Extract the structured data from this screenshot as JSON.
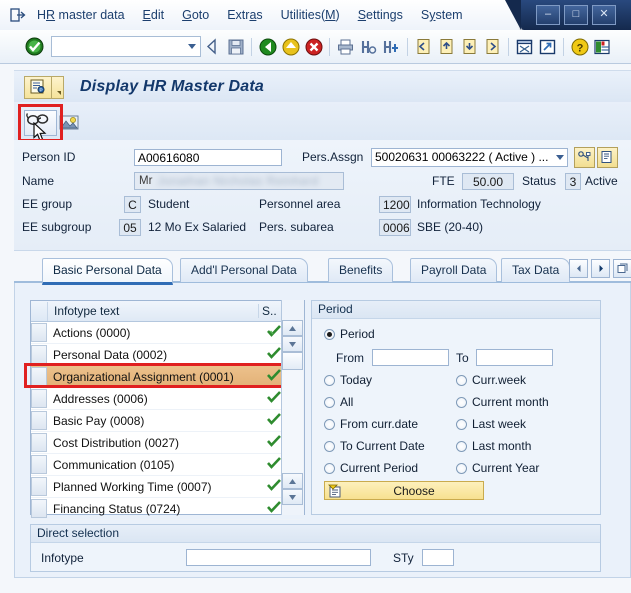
{
  "window": {
    "controls": [
      {
        "name": "minimize",
        "glyph": "–"
      },
      {
        "name": "maximize",
        "glyph": "□"
      },
      {
        "name": "close",
        "glyph": "✕"
      }
    ],
    "overflow_glyph": "»"
  },
  "menu": {
    "exit_icon": "exit-icon",
    "items": [
      {
        "label": "HR master data",
        "accel": "R",
        "accel_index": 2
      },
      {
        "label": "Edit",
        "accel": "E",
        "accel_index": 0
      },
      {
        "label": "Goto",
        "accel": "G",
        "accel_index": 0
      },
      {
        "label": "Extras",
        "accel": "a",
        "accel_index": 4
      },
      {
        "label": "Utilities(M)",
        "accel": "M",
        "accel_index": 10
      },
      {
        "label": "Settings",
        "accel": "S",
        "accel_index": 0
      },
      {
        "label": "System",
        "accel": "y",
        "accel_index": 1
      }
    ]
  },
  "toolbar": {
    "command_field_value": "",
    "command_field_placeholder": "",
    "icons": [
      "enter-checkmark-icon",
      "back-arrow-icon",
      "save-icon",
      "back-green-icon",
      "exit-yellow-icon",
      "cancel-red-icon",
      "print-icon",
      "find-icon",
      "find-next-icon",
      "first-page-icon",
      "previous-page-icon",
      "next-page-icon",
      "last-page-icon",
      "new-window-icon",
      "create-shortcut-icon",
      "help-icon",
      "customize-layout-icon"
    ]
  },
  "page": {
    "title": "Display HR Master Data",
    "title_icon": "transaction-icon"
  },
  "app_toolbar": {
    "display_button": "display-glasses-icon",
    "person_button": "person-photo-icon",
    "cursor": "mouse-cursor"
  },
  "header": {
    "person_id_label": "Person ID",
    "person_id_value": "A00616080",
    "pers_assgn_label": "Pers.Assgn",
    "pers_assgn_value": "50020631 00063222 ( Active ) ...",
    "name_label": "Name",
    "name_title": "Mr",
    "name_value": "Jonathan Nicholas Reinhard",
    "fte_label": "FTE",
    "fte_value": "50.00",
    "status_label": "Status",
    "status_code": "3",
    "status_text": "Active",
    "ee_group_label": "EE group",
    "ee_group_code": "C",
    "ee_group_text": "Student",
    "personnel_area_label": "Personnel area",
    "personnel_area_code": "1200",
    "personnel_area_text": "Information Technology",
    "ee_subgroup_label": "EE subgroup",
    "ee_subgroup_code": "05",
    "ee_subgroup_text": "12 Mo Ex Salaried",
    "pers_subarea_label": "Pers. subarea",
    "pers_subarea_code": "0006",
    "pers_subarea_text": "SBE (20-40)"
  },
  "tabs": {
    "items": [
      {
        "label": "Basic Personal Data",
        "active": true
      },
      {
        "label": "Add'l Personal Data",
        "active": false
      },
      {
        "label": "Benefits",
        "active": false
      },
      {
        "label": "Payroll Data",
        "active": false
      },
      {
        "label": "Tax Data",
        "active": false
      }
    ],
    "nav": [
      "scroll-left-icon",
      "scroll-right-icon",
      "tab-list-icon"
    ]
  },
  "infotype_table": {
    "columns": {
      "select": "",
      "text": "Infotype text",
      "status": "S.."
    },
    "rows": [
      {
        "label": "Actions (0000)",
        "status": "check",
        "highlighted": false
      },
      {
        "label": "Personal Data (0002)",
        "status": "check",
        "highlighted": false
      },
      {
        "label": "Organizational Assignment (0001)",
        "status": "check",
        "highlighted": true
      },
      {
        "label": "Addresses (0006)",
        "status": "check",
        "highlighted": false
      },
      {
        "label": "Basic Pay (0008)",
        "status": "check",
        "highlighted": false
      },
      {
        "label": "Cost Distribution (0027)",
        "status": "check",
        "highlighted": false
      },
      {
        "label": "Communication (0105)",
        "status": "check",
        "highlighted": false
      },
      {
        "label": "Planned Working Time (0007)",
        "status": "check",
        "highlighted": false
      },
      {
        "label": "Financing Status (0724)",
        "status": "check",
        "highlighted": false
      }
    ]
  },
  "period": {
    "title": "Period",
    "period_option": "Period",
    "from_label": "From",
    "from_value": "",
    "to_label": "To",
    "to_value": "",
    "options_left": [
      "Today",
      "All",
      "From curr.date",
      "To Current Date",
      "Current Period"
    ],
    "options_right": [
      "Curr.week",
      "Current month",
      "Last week",
      "Last month",
      "Current Year"
    ],
    "selected": "Period",
    "choose_label": "Choose",
    "choose_icon": "list-choose-icon"
  },
  "direct_selection": {
    "title": "Direct selection",
    "infotype_label": "Infotype",
    "infotype_value": "",
    "sty_label": "STy",
    "sty_value": ""
  },
  "colors": {
    "accent_blue": "#2f6cb5",
    "highlight_orange": "#e3b176",
    "annotation_red": "#e02020",
    "check_green": "#2f8c2f",
    "button_yellow": "#f7e190"
  }
}
